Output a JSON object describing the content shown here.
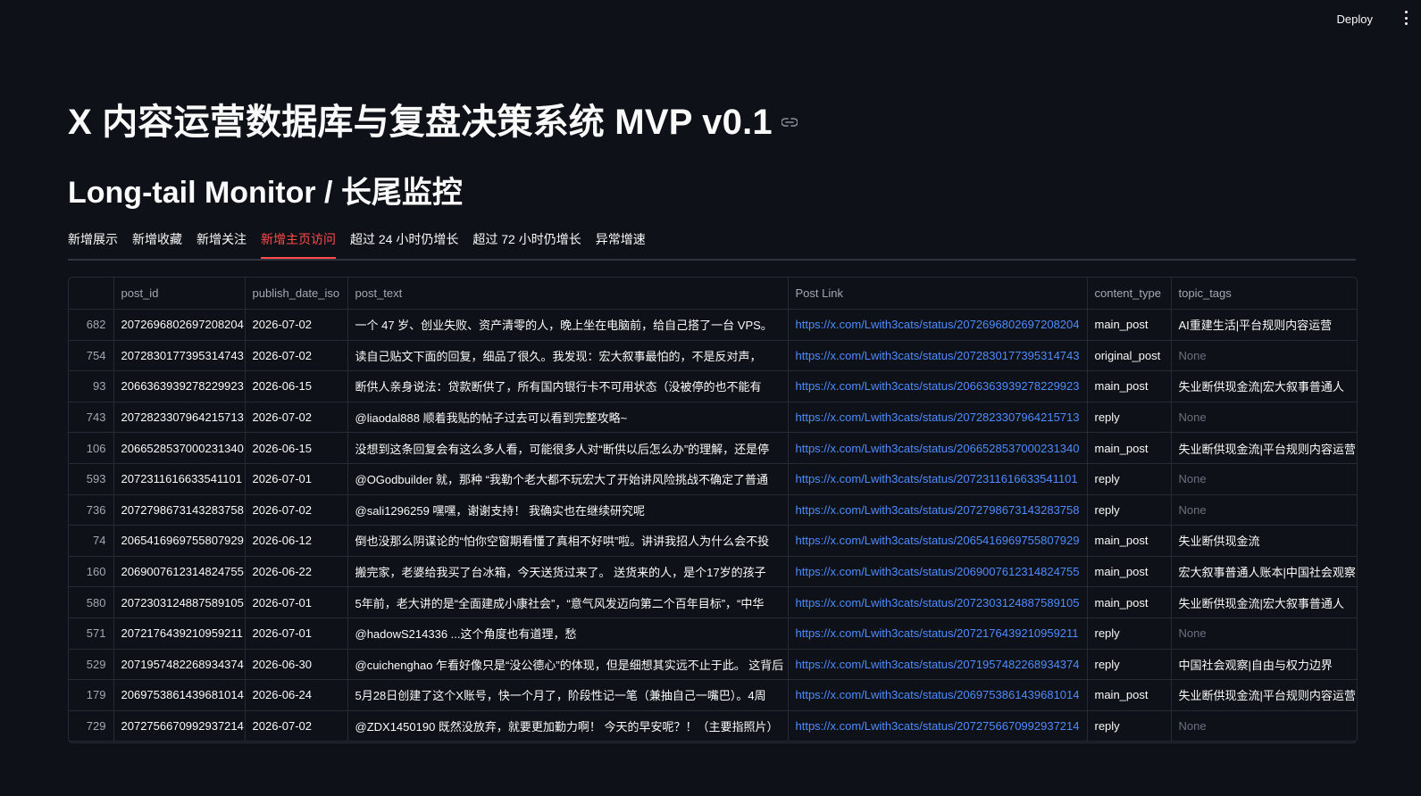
{
  "topbar": {
    "deploy_label": "Deploy"
  },
  "header": {
    "title": "X 内容运营数据库与复盘决策系统 MVP v0.1",
    "subtitle": "Long-tail Monitor / 长尾监控"
  },
  "tabs": [
    {
      "label": "新增展示",
      "active": false
    },
    {
      "label": "新增收藏",
      "active": false
    },
    {
      "label": "新增关注",
      "active": false
    },
    {
      "label": "新增主页访问",
      "active": true
    },
    {
      "label": "超过 24 小时仍增长",
      "active": false
    },
    {
      "label": "超过 72 小时仍增长",
      "active": false
    },
    {
      "label": "异常增速",
      "active": false
    }
  ],
  "table": {
    "columns": [
      "",
      "post_id",
      "publish_date_iso",
      "post_text",
      "Post Link",
      "content_type",
      "topic_tags"
    ],
    "rows": [
      {
        "idx": "682",
        "post_id": "2072696802697208204",
        "date": "2026-07-02",
        "text": "一个 47 岁、创业失败、资产清零的人，晚上坐在电脑前，给自己搭了一台 VPS。",
        "link": "https://x.com/Lwith3cats/status/2072696802697208204",
        "type": "main_post",
        "tags": "AI重建生活|平台规则内容运营"
      },
      {
        "idx": "754",
        "post_id": "2072830177395314743",
        "date": "2026-07-02",
        "text": "读自己贴文下面的回复，细品了很久。我发现：宏大叙事最怕的，不是反对声，",
        "link": "https://x.com/Lwith3cats/status/2072830177395314743",
        "type": "original_post",
        "tags": "None"
      },
      {
        "idx": "93",
        "post_id": "2066363939278229923",
        "date": "2026-06-15",
        "text": "断供人亲身说法：贷款断供了，所有国内银行卡不可用状态（没被停的也不能有",
        "link": "https://x.com/Lwith3cats/status/2066363939278229923",
        "type": "main_post",
        "tags": "失业断供现金流|宏大叙事普通人"
      },
      {
        "idx": "743",
        "post_id": "2072823307964215713",
        "date": "2026-07-02",
        "text": "@liaodal888 顺着我贴的帖子过去可以看到完整攻略~",
        "link": "https://x.com/Lwith3cats/status/2072823307964215713",
        "type": "reply",
        "tags": "None"
      },
      {
        "idx": "106",
        "post_id": "2066528537000231340",
        "date": "2026-06-15",
        "text": "没想到这条回复会有这么多人看，可能很多人对“断供以后怎么办”的理解，还是停",
        "link": "https://x.com/Lwith3cats/status/2066528537000231340",
        "type": "main_post",
        "tags": "失业断供现金流|平台规则内容运营"
      },
      {
        "idx": "593",
        "post_id": "2072311616633541101",
        "date": "2026-07-01",
        "text": "@OGodbuilder 就，那种 “我勒个老大都不玩宏大了开始讲风险挑战不确定了普通",
        "link": "https://x.com/Lwith3cats/status/2072311616633541101",
        "type": "reply",
        "tags": "None"
      },
      {
        "idx": "736",
        "post_id": "2072798673143283758",
        "date": "2026-07-02",
        "text": "@sali1296259 嘿嘿，谢谢支持！ 我确实也在继续研究呢",
        "link": "https://x.com/Lwith3cats/status/2072798673143283758",
        "type": "reply",
        "tags": "None"
      },
      {
        "idx": "74",
        "post_id": "2065416969755807929",
        "date": "2026-06-12",
        "text": "倒也没那么阴谋论的“怕你空窗期看懂了真相不好哄”啦。讲讲我招人为什么会不投",
        "link": "https://x.com/Lwith3cats/status/2065416969755807929",
        "type": "main_post",
        "tags": "失业断供现金流"
      },
      {
        "idx": "160",
        "post_id": "2069007612314824755",
        "date": "2026-06-22",
        "text": "搬完家，老婆给我买了台冰箱，今天送货过来了。 送货来的人，是个17岁的孩子",
        "link": "https://x.com/Lwith3cats/status/2069007612314824755",
        "type": "main_post",
        "tags": "宏大叙事普通人账本|中国社会观察"
      },
      {
        "idx": "580",
        "post_id": "2072303124887589105",
        "date": "2026-07-01",
        "text": "5年前，老大讲的是“全面建成小康社会”，“意气风发迈向第二个百年目标”，“中华",
        "link": "https://x.com/Lwith3cats/status/2072303124887589105",
        "type": "main_post",
        "tags": "失业断供现金流|宏大叙事普通人"
      },
      {
        "idx": "571",
        "post_id": "2072176439210959211",
        "date": "2026-07-01",
        "text": "@hadowS214336 ...这个角度也有道理，愁",
        "link": "https://x.com/Lwith3cats/status/2072176439210959211",
        "type": "reply",
        "tags": "None"
      },
      {
        "idx": "529",
        "post_id": "2071957482268934374",
        "date": "2026-06-30",
        "text": "@cuichenghao 乍看好像只是“没公德心”的体现，但是细想其实远不止于此。 这背后",
        "link": "https://x.com/Lwith3cats/status/2071957482268934374",
        "type": "reply",
        "tags": "中国社会观察|自由与权力边界"
      },
      {
        "idx": "179",
        "post_id": "2069753861439681014",
        "date": "2026-06-24",
        "text": "5月28日创建了这个X账号，快一个月了，阶段性记一笔（兼抽自己一嘴巴）。4周",
        "link": "https://x.com/Lwith3cats/status/2069753861439681014",
        "type": "main_post",
        "tags": "失业断供现金流|平台规则内容运营"
      },
      {
        "idx": "729",
        "post_id": "2072756670992937214",
        "date": "2026-07-02",
        "text": "@ZDX1450190 既然没放弃，就要更加勤力啊！ 今天的早安呢？！（主要指照片）",
        "link": "https://x.com/Lwith3cats/status/2072756670992937214",
        "type": "reply",
        "tags": "None"
      }
    ]
  },
  "colors": {
    "background": "#0e1117",
    "accent": "#ff4b4b",
    "link": "#4e8cff"
  }
}
